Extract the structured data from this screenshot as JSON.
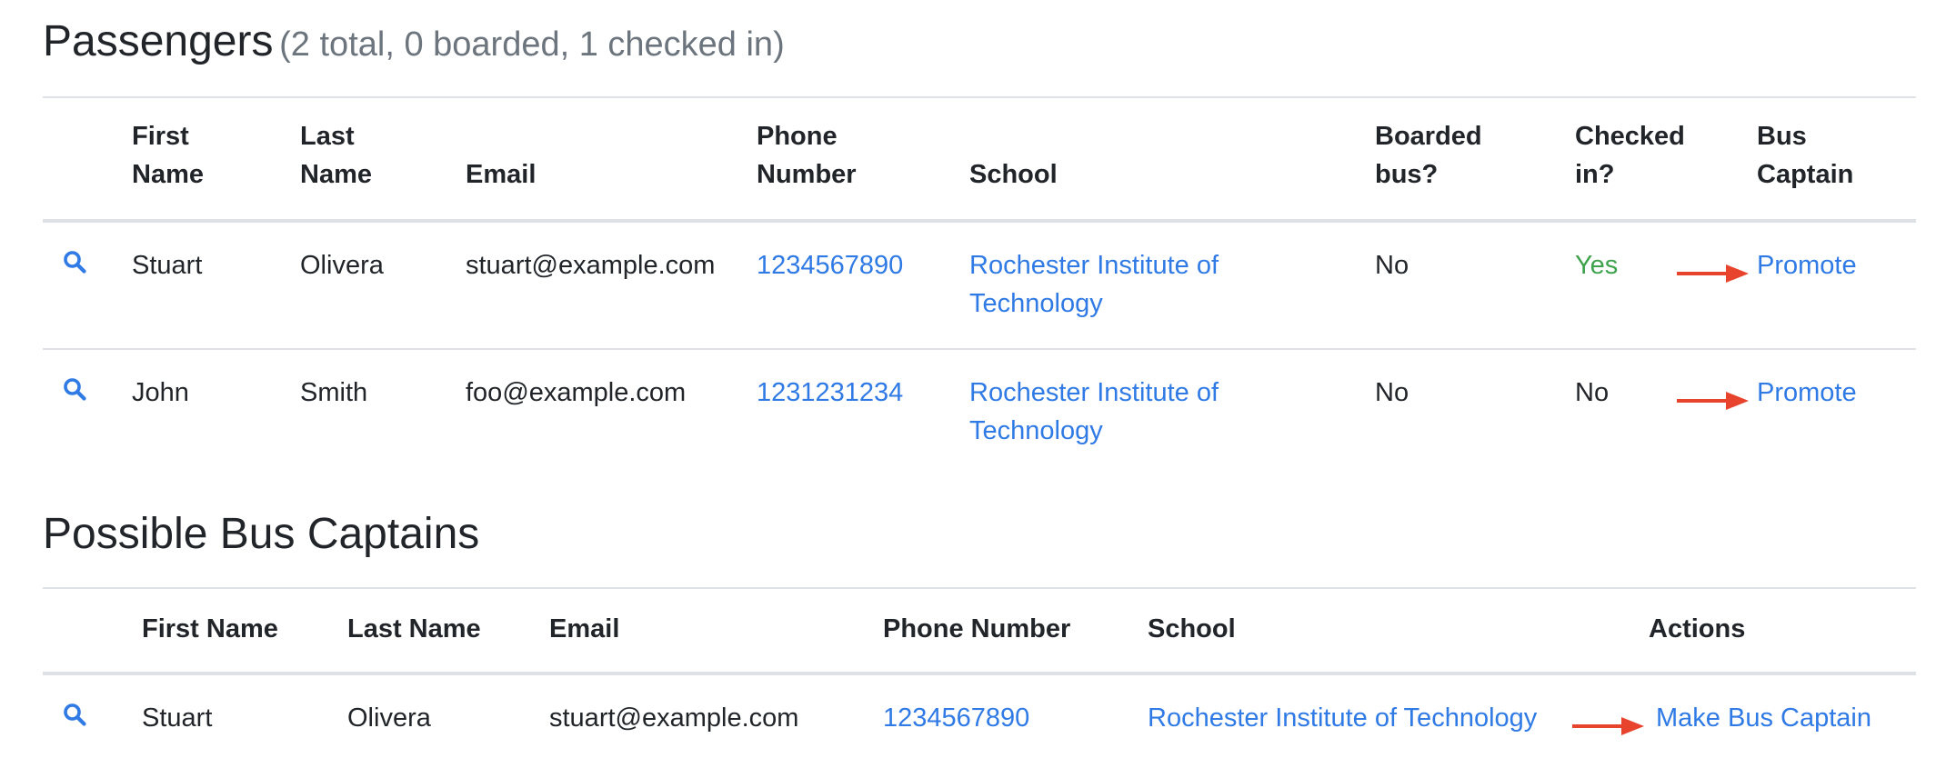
{
  "passengers": {
    "title": "Passengers",
    "summary": "(2 total, 0 boarded, 1 checked in)",
    "columns": {
      "first_name": "First Name",
      "last_name": "Last Name",
      "email": "Email",
      "phone": "Phone Number",
      "school": "School",
      "boarded": "Boarded bus?",
      "checked_in": "Checked in?",
      "bus_captain": "Bus Captain"
    },
    "rows": [
      {
        "first_name": "Stuart",
        "last_name": "Olivera",
        "email": "stuart@example.com",
        "phone": "1234567890",
        "school": "Rochester Institute of Technology",
        "boarded": "No",
        "checked_in": "Yes",
        "action": "Promote"
      },
      {
        "first_name": "John",
        "last_name": "Smith",
        "email": "foo@example.com",
        "phone": "1231231234",
        "school": "Rochester Institute of Technology",
        "boarded": "No",
        "checked_in": "No",
        "action": "Promote"
      }
    ]
  },
  "captains": {
    "title": "Possible Bus Captains",
    "columns": {
      "first_name": "First Name",
      "last_name": "Last Name",
      "email": "Email",
      "phone": "Phone Number",
      "school": "School",
      "actions": "Actions"
    },
    "rows": [
      {
        "first_name": "Stuart",
        "last_name": "Olivera",
        "email": "stuart@example.com",
        "phone": "1234567890",
        "school": "Rochester Institute of Technology",
        "action": "Make Bus Captain"
      }
    ]
  },
  "icons": {
    "view": "search-icon",
    "annotation": "red-arrow-icon"
  },
  "colors": {
    "link": "#2f7ae5",
    "yes": "#3fa34d",
    "arrow": "#e8432c",
    "muted": "#6c757d"
  }
}
